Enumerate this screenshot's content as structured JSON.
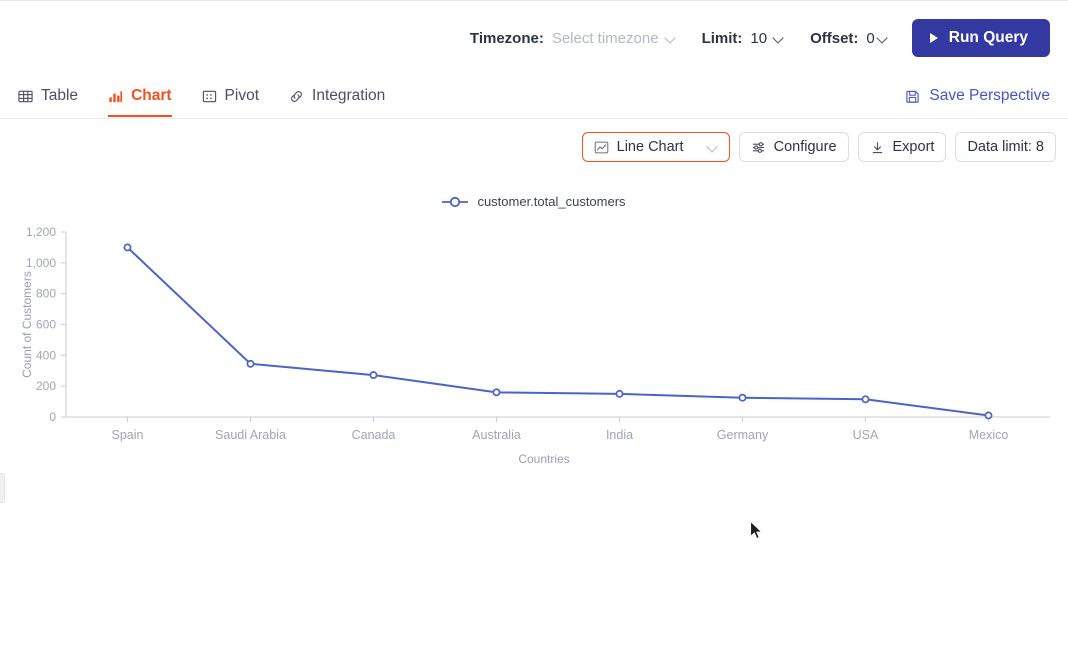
{
  "topbar": {
    "timezone_label": "Timezone:",
    "timezone_value": "Select timezone",
    "limit_label": "Limit:",
    "limit_value": "10",
    "offset_label": "Offset:",
    "offset_value": "0",
    "run_query_label": "Run Query"
  },
  "tabs": [
    {
      "label": "Table",
      "icon": "table-icon",
      "active": false
    },
    {
      "label": "Chart",
      "icon": "chart-icon",
      "active": true
    },
    {
      "label": "Pivot",
      "icon": "pivot-icon",
      "active": false
    },
    {
      "label": "Integration",
      "icon": "link-icon",
      "active": false
    }
  ],
  "save_perspective": {
    "label": "Save Perspective",
    "icon": "save-icon"
  },
  "chart_toolbar": {
    "chart_type_value": "Line Chart",
    "configure_label": "Configure",
    "export_label": "Export",
    "data_limit_label": "Data limit: 8"
  },
  "colors": {
    "accent_orange": "#f4511e",
    "primary_indigo": "#3339a0",
    "link_blue": "#4355c7",
    "series_blue": "#4a63c8"
  },
  "chart_data": {
    "type": "line",
    "title": "",
    "xlabel": "Countries",
    "ylabel": "Count of Customers",
    "categories": [
      "Spain",
      "Saudi Arabia",
      "Canada",
      "Australia",
      "India",
      "Germany",
      "USA",
      "Mexico"
    ],
    "series": [
      {
        "name": "customer.total_customers",
        "values": [
          1100,
          345,
          272,
          160,
          150,
          125,
          115,
          10
        ]
      }
    ],
    "ylim": [
      0,
      1200
    ],
    "yticks": [
      0,
      200,
      400,
      600,
      800,
      1000,
      1200
    ],
    "ytick_labels": [
      "0",
      "200",
      "400",
      "600",
      "800",
      "1,000",
      "1,200"
    ],
    "grid": false,
    "legend": "top-center",
    "legend_entries": [
      "customer.total_customers"
    ]
  }
}
